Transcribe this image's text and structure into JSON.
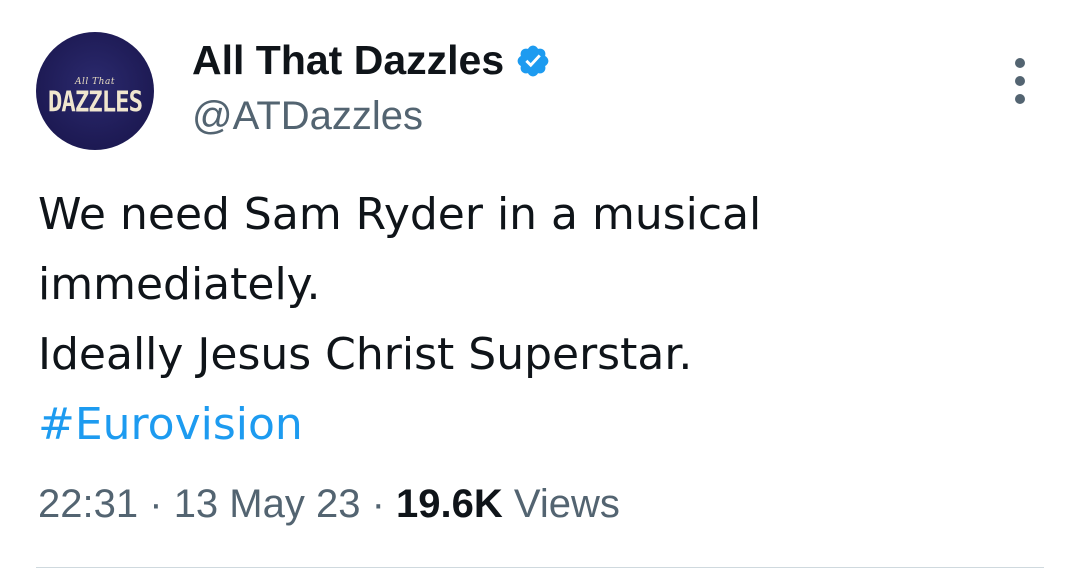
{
  "author": {
    "display_name": "All That Dazzles",
    "handle": "@ATDazzles",
    "avatar_logo_small": "All That",
    "avatar_logo_main": "DAZZLES",
    "verified_icon": "verified-badge-icon",
    "verified_color": "#1d9bf0"
  },
  "tweet": {
    "lines": [
      "We need Sam Ryder in a musical",
      "immediately.",
      "Ideally Jesus Christ Superstar."
    ],
    "hashtag": "#Eurovision"
  },
  "meta": {
    "time": "22:31",
    "separator": "·",
    "date": "13 May 23",
    "views_count": "19.6K",
    "views_label": "Views"
  },
  "colors": {
    "text": "#0f1419",
    "secondary": "#536471",
    "link": "#1d9bf0"
  },
  "icons": {
    "more": "more-options-icon"
  }
}
